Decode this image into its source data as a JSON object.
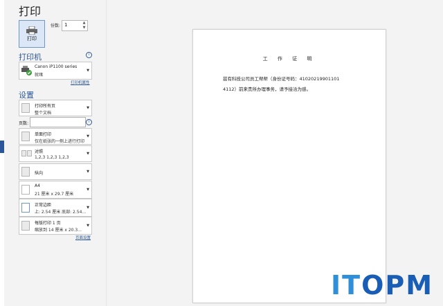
{
  "title": "打印",
  "print_button": {
    "label": "打印"
  },
  "copies": {
    "label": "份数:",
    "value": "1"
  },
  "printer": {
    "section_title": "打印机",
    "name": "Canon iP1100 series",
    "status": "就绪",
    "properties_link": "打印机属性"
  },
  "settings": {
    "section_title": "设置",
    "pages_label": "页数:",
    "items": [
      {
        "line1": "打印所有页",
        "line2": "整个文档",
        "icon": "pages-icon"
      },
      {
        "line1": "单面打印",
        "line2": "仅在纸张的一侧上进行打印",
        "icon": "single-side-icon"
      },
      {
        "line1": "对照",
        "line2": "1,2,3    1,2,3    1,2,3",
        "icon": "collate-icon"
      },
      {
        "line1": "纵向",
        "line2": "",
        "icon": "portrait-icon"
      },
      {
        "line1": "A4",
        "line2": "21 厘米 x 29.7 厘米",
        "icon": "paper-size-icon"
      },
      {
        "line1": "正常边距",
        "line2": "上: 2.54 厘米 底部: 2.54...",
        "icon": "margins-icon"
      },
      {
        "line1": "每版打印 1 页",
        "line2": "缩放到 14 厘米 x 20.3...",
        "icon": "pages-per-sheet-icon"
      }
    ],
    "page_setup_link": "页面设置"
  },
  "preview": {
    "doc_title": "工 作 证 明",
    "line1": "兹有科技公司员工帮帮（身份证号码：41020219901101",
    "line2": "4112）前来贵所办理事务，请予接洽为感。"
  },
  "watermark": {
    "part1": "IT",
    "part2": "OPM"
  },
  "colors": {
    "accent": "#2b579a",
    "watermark_light": "#2f8fd8",
    "watermark_dark": "#1a5db5"
  }
}
